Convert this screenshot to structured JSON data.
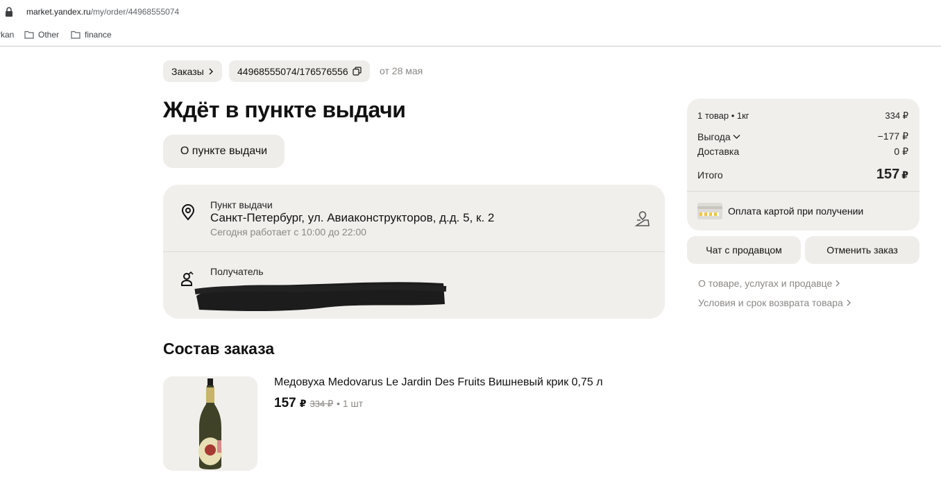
{
  "browser": {
    "url_domain": "market.yandex.ru",
    "url_path": "/my/order/44968555074",
    "bookmarks": [
      {
        "label": "rkan"
      },
      {
        "label": "Other"
      },
      {
        "label": "finance"
      }
    ]
  },
  "header": {
    "orders_chip": "Заказы",
    "order_number": "44968555074/176576556",
    "order_date": "от 28 мая",
    "status_title": "Ждёт в пункте выдачи",
    "pickup_info_button": "О пункте выдачи"
  },
  "pickup": {
    "label": "Пункт выдачи",
    "address": "Санкт-Петербург, ул. Авиаконструкторов, д.д. 5, к. 2",
    "hours": "Сегодня работает с 10:00 до 22:00"
  },
  "recipient": {
    "label": "Получатель"
  },
  "order_items": {
    "title": "Состав заказа",
    "items": [
      {
        "name": "Медовуха Medovarus Le Jardin Des Fruits Вишневый крик 0,75 л",
        "price": "157",
        "currency": "₽",
        "old_price": "334 ₽",
        "quantity": "• 1 шт"
      }
    ]
  },
  "summary": {
    "items_count": "1 товар • 1кг",
    "items_sum": "334 ₽",
    "benefit_label": "Выгода",
    "benefit_value": "−177 ₽",
    "delivery_label": "Доставка",
    "delivery_value": "0 ₽",
    "total_label": "Итого",
    "total_value": "157",
    "total_currency": "₽",
    "payment": "Оплата картой при получении",
    "chat_button": "Чат с продавцом",
    "cancel_button": "Отменить заказ",
    "link_about": "О товаре, услугах и продавце",
    "link_return": "Условия и срок возврата товара"
  }
}
